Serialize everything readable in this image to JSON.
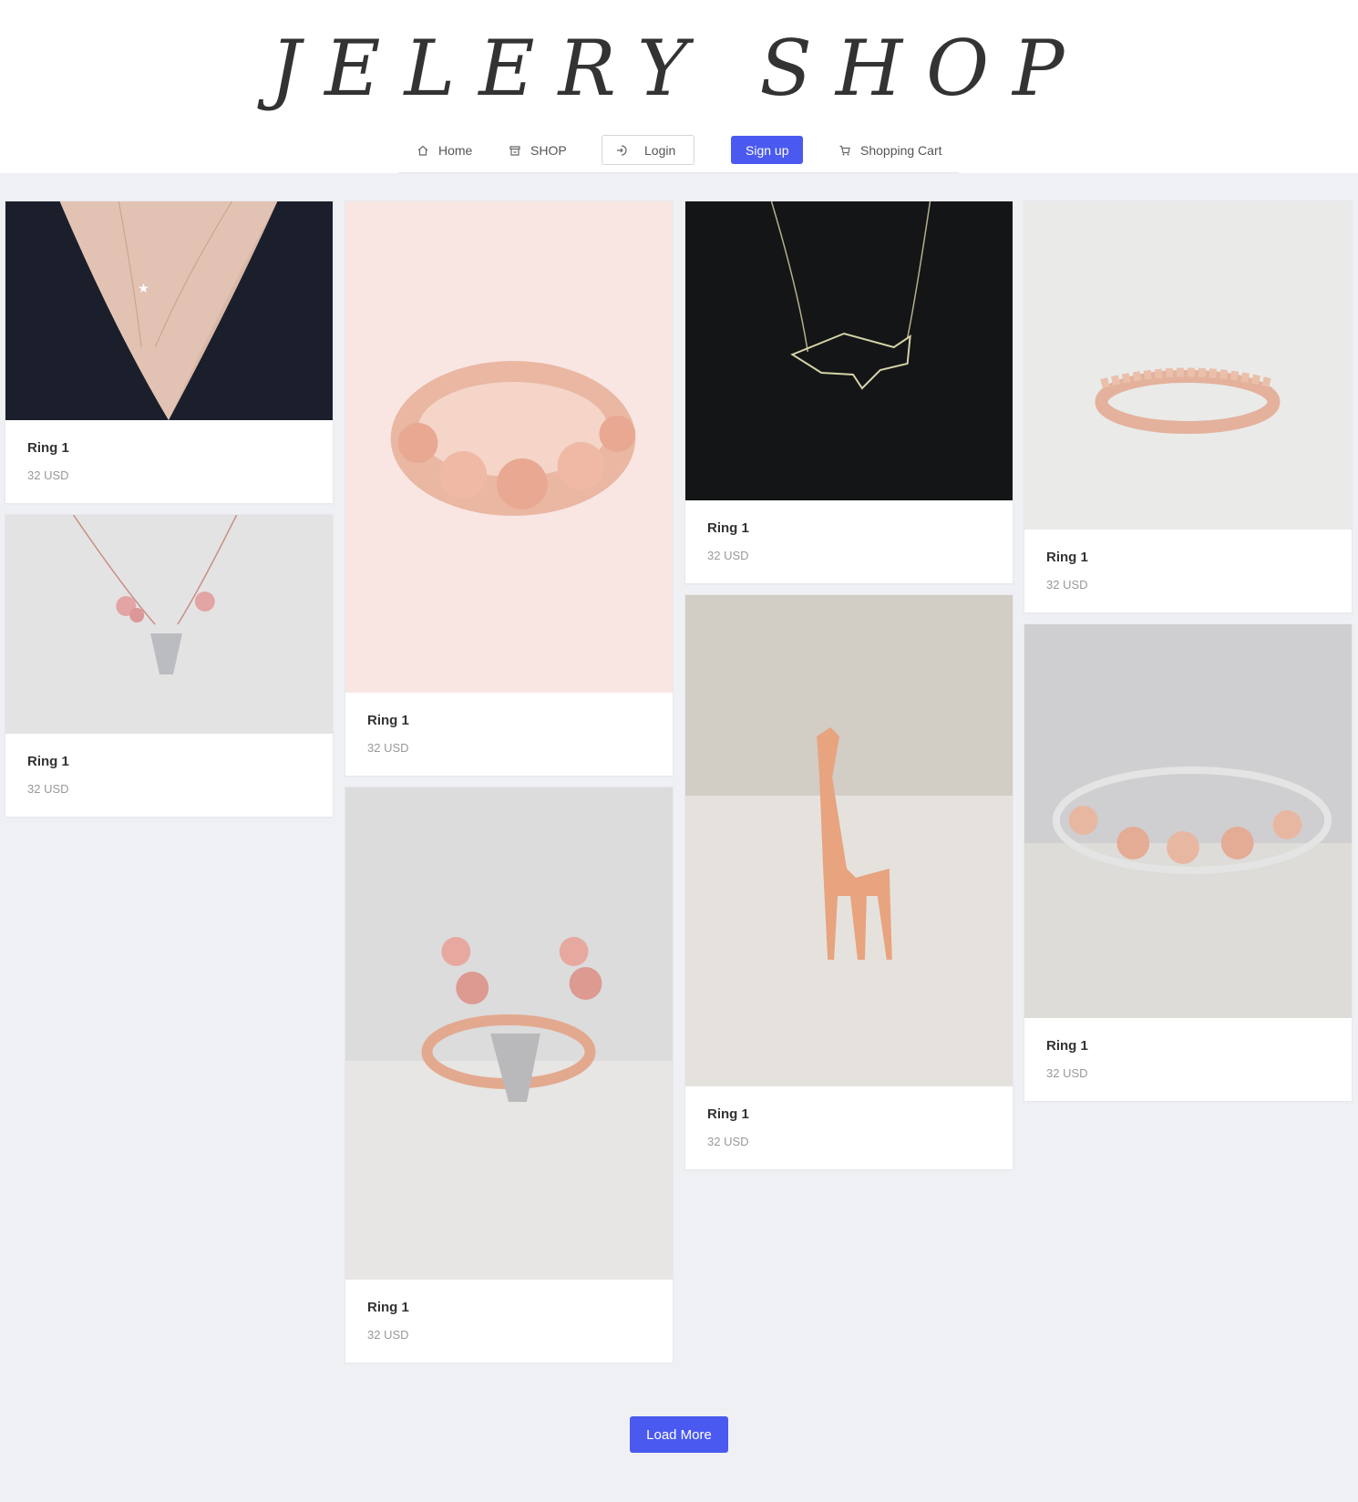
{
  "brand": {
    "title": "JELERY SHOP"
  },
  "nav": {
    "home": "Home",
    "shop": "SHOP",
    "login": "Login",
    "signup": "Sign up",
    "cart": "Shopping Cart"
  },
  "products": [
    {
      "title": "Ring 1",
      "price": "32 USD",
      "image": "necklace-star-moon"
    },
    {
      "title": "Ring 1",
      "price": "32 USD",
      "image": "necklace-deer-flowers"
    },
    {
      "title": "Ring 1",
      "price": "32 USD",
      "image": "ring-rose-gold-flowers"
    },
    {
      "title": "Ring 1",
      "price": "32 USD",
      "image": "ring-deer-antlers"
    },
    {
      "title": "Ring 1",
      "price": "32 USD",
      "image": "necklace-geometric-whale"
    },
    {
      "title": "Ring 1",
      "price": "32 USD",
      "image": "rose-gold-giraffe-figure"
    },
    {
      "title": "Ring 1",
      "price": "32 USD",
      "image": "ring-lace-rose-gold"
    },
    {
      "title": "Ring 1",
      "price": "32 USD",
      "image": "ring-flower-band"
    }
  ],
  "load_more": "Load More",
  "colors": {
    "accent": "#4a5af0",
    "background": "#eff0f4",
    "card": "#ffffff"
  }
}
